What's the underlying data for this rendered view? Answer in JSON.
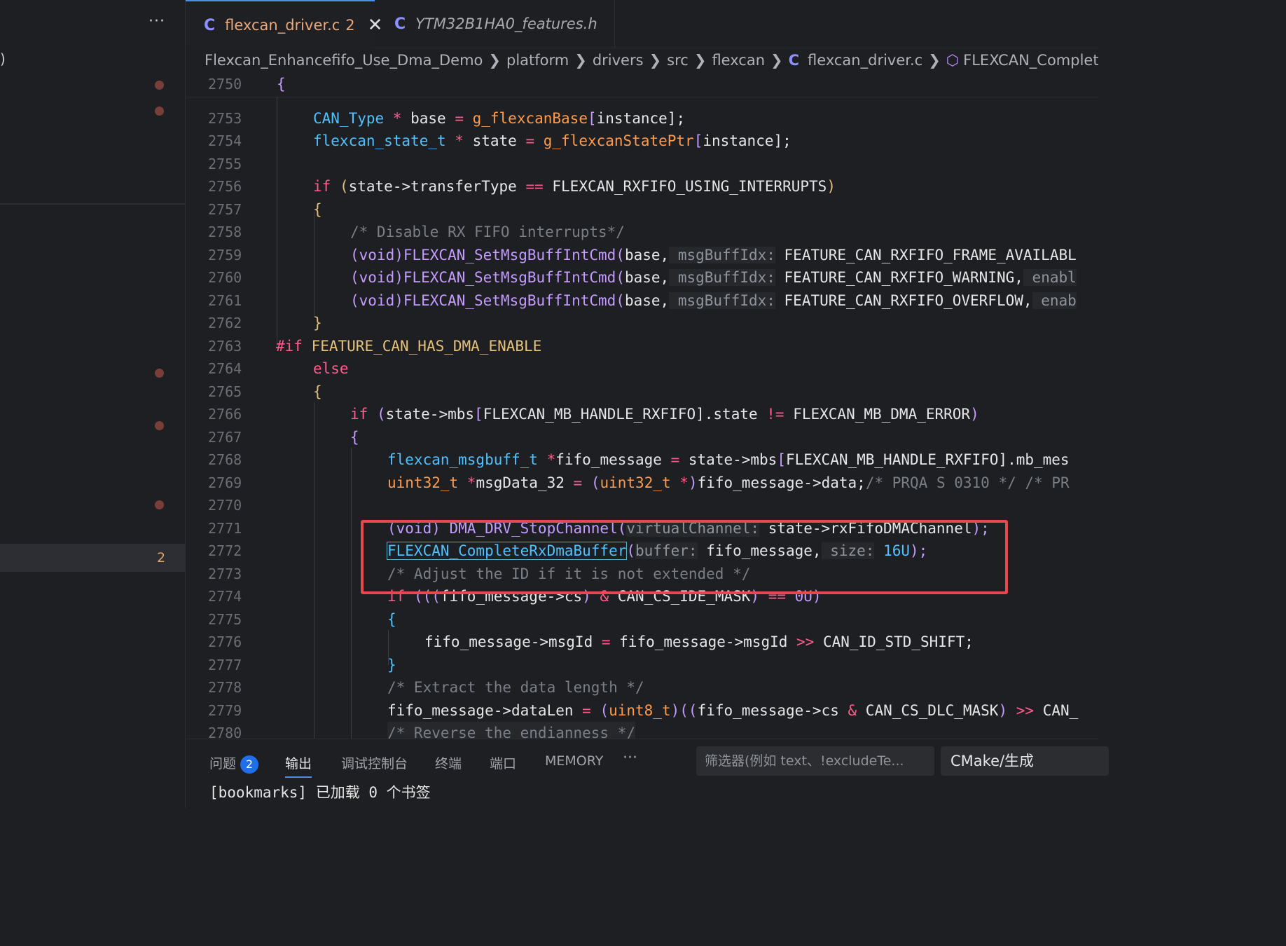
{
  "sidebar": {
    "more": "···",
    "paren": ")",
    "problem_count": "2"
  },
  "tabs": [
    {
      "icon": "C",
      "name": "flexcan_driver.c",
      "badge": "2",
      "close": "✕"
    },
    {
      "icon": "C",
      "name": "YTM32B1HA0_features.h"
    }
  ],
  "breadcrumb": [
    "Flexcan_Enhancefifo_Use_Dma_Demo",
    "platform",
    "drivers",
    "src",
    "flexcan",
    "flexcan_driver.c",
    "FLEXCAN_CompleteRxDmaBu"
  ],
  "breadcrumb_c_icon": "C",
  "sticky": {
    "num": "2750",
    "code": "{"
  },
  "lines": [
    {
      "n": "2753"
    },
    {
      "n": "2754"
    },
    {
      "n": "2755"
    },
    {
      "n": "2756"
    },
    {
      "n": "2757"
    },
    {
      "n": "2758"
    },
    {
      "n": "2759"
    },
    {
      "n": "2760"
    },
    {
      "n": "2761"
    },
    {
      "n": "2762"
    },
    {
      "n": "2763"
    },
    {
      "n": "2764"
    },
    {
      "n": "2765"
    },
    {
      "n": "2766"
    },
    {
      "n": "2767"
    },
    {
      "n": "2768"
    },
    {
      "n": "2769"
    },
    {
      "n": "2770"
    },
    {
      "n": "2771"
    },
    {
      "n": "2772"
    },
    {
      "n": "2773"
    },
    {
      "n": "2774"
    },
    {
      "n": "2775"
    },
    {
      "n": "2776"
    },
    {
      "n": "2777"
    },
    {
      "n": "2778"
    },
    {
      "n": "2779"
    },
    {
      "n": "2780"
    }
  ],
  "code": {
    "l2753": [
      "CAN_Type",
      " * ",
      "base",
      " = ",
      "g_flexcanBase",
      "[",
      "instance",
      "];"
    ],
    "l2754": [
      "flexcan_state_t",
      " * ",
      "state",
      " = ",
      "g_flexcanStatePtr",
      "[",
      "instance",
      "];"
    ],
    "l2756": [
      "if",
      " (",
      "state->transferType",
      " == ",
      "FLEXCAN_RXFIFO_USING_INTERRUPTS",
      ")"
    ],
    "l2757": [
      "{"
    ],
    "l2758": [
      "/* Disable RX FIFO interrupts*/"
    ],
    "l2759": [
      "(void)",
      "FLEXCAN_SetMsgBuffIntCmd",
      "(",
      "base,",
      " msgBuffIdx:",
      " FEATURE_CAN_RXFIFO_FRAME_AVAILABL"
    ],
    "l2760": [
      "(void)",
      "FLEXCAN_SetMsgBuffIntCmd",
      "(",
      "base,",
      " msgBuffIdx:",
      " FEATURE_CAN_RXFIFO_WARNING,",
      " enabl"
    ],
    "l2761": [
      "(void)",
      "FLEXCAN_SetMsgBuffIntCmd",
      "(",
      "base,",
      " msgBuffIdx:",
      " FEATURE_CAN_RXFIFO_OVERFLOW,",
      " enab"
    ],
    "l2762": [
      "}"
    ],
    "l2763": [
      "#if",
      " FEATURE_CAN_HAS_DMA_ENABLE"
    ],
    "l2764": [
      "else"
    ],
    "l2765": [
      "{"
    ],
    "l2766": [
      "if",
      " (",
      "state->mbs",
      "[",
      "FLEXCAN_MB_HANDLE_RXFIFO",
      "].state",
      " != ",
      "FLEXCAN_MB_DMA_ERROR",
      ")"
    ],
    "l2767": [
      "{"
    ],
    "l2768": [
      "flexcan_msgbuff_t",
      " *",
      "fifo_message",
      " = ",
      "state->mbs",
      "[",
      "FLEXCAN_MB_HANDLE_RXFIFO",
      "].mb_mes"
    ],
    "l2769": [
      "uint32_t",
      " *",
      "msgData_32",
      " = ",
      "(",
      "uint32_t",
      " *",
      ")",
      "fifo_message->data;",
      "/* PRQA S 0310 */ /* PR"
    ],
    "l2771": [
      "(void)",
      " DMA_DRV_StopChannel",
      "(",
      "virtualChannel:",
      " state->rxFifoDMAChannel",
      ");"
    ],
    "l2772": [
      "FLEXCAN_CompleteRxDmaBuffer",
      "(",
      "buffer:",
      " fifo_message,",
      " size:",
      " 16U",
      ");"
    ],
    "l2773": [
      "/* Adjust the ID if it is not extended */"
    ],
    "l2774": [
      "if",
      " (((",
      "fifo_message->cs",
      ")",
      " & ",
      "CAN_CS_IDE_MASK",
      ")",
      " == ",
      "0U",
      ")"
    ],
    "l2775": [
      "{"
    ],
    "l2776": [
      "fifo_message->msgId",
      " = ",
      "fifo_message->msgId",
      " >> ",
      "CAN_ID_STD_SHIFT;"
    ],
    "l2777": [
      "}"
    ],
    "l2778": [
      "/* Extract the data length */"
    ],
    "l2779": [
      "fifo_message->dataLen",
      " = ",
      "(",
      "uint8_t",
      ")((",
      "fifo_message->cs",
      " & ",
      "CAN_CS_DLC_MASK",
      ")",
      " >> ",
      "CAN_"
    ],
    "l2780": [
      "/* Reverse the endianness */"
    ]
  },
  "panel": {
    "tabs": [
      "问题",
      "输出",
      "调试控制台",
      "终端",
      "端口",
      "MEMORY"
    ],
    "problems_badge": "2",
    "more": "···",
    "filter_placeholder": "筛选器(例如 text、!excludeTe...",
    "cmake_select": "CMake/生成",
    "output_line": "[bookmarks] 已加载 0 个书签"
  },
  "colors": {
    "accent": "#4f8ee8",
    "highlight_box": "#e5484d",
    "badge": "#1f6feb"
  }
}
